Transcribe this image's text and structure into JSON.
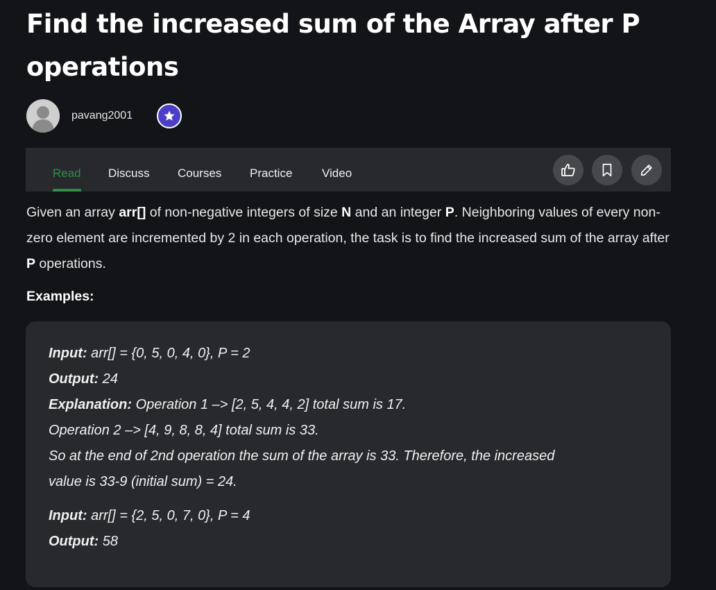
{
  "article": {
    "title": "Find the increased sum of the Array after P operations",
    "author": "pavang2001"
  },
  "tabs": [
    {
      "label": "Read",
      "active": true
    },
    {
      "label": "Discuss",
      "active": false
    },
    {
      "label": "Courses",
      "active": false
    },
    {
      "label": "Practice",
      "active": false
    },
    {
      "label": "Video",
      "active": false
    }
  ],
  "actions": {
    "like_icon": "thumbs-up-icon",
    "bookmark_icon": "bookmark-icon",
    "edit_icon": "pencil-icon"
  },
  "intro": {
    "t1": "Given an array ",
    "b1": "arr[]",
    "t2": " of non-negative integers of size ",
    "b2": "N",
    "t3": " and an integer ",
    "b3": "P",
    "t4": ". Neighboring values of every non-zero element are incremented by 2 in each operation, the task is to find the increased sum of the array after ",
    "b4": "P",
    "t5": " operations."
  },
  "examples_label": "Examples:",
  "examples": {
    "input_label": "Input:",
    "output_label": "Output:",
    "explanation_label": "Explanation:",
    "ex1_input": " arr[] = {0, 5, 0, 4, 0}, P = 2",
    "ex1_output": " 24",
    "ex1_explanation": " Operation 1 –> [2, 5, 4, 4, 2] total sum is 17.",
    "ex1_line2": "Operation 2 –> [4, 9, 8, 8, 4] total sum is 33.",
    "ex1_line3": "So at the end of 2nd operation the sum of the array is 33. Therefore, the increased",
    "ex1_line4": "value is 33-9 (initial sum) = 24.",
    "ex2_input": " arr[] = {2, 5, 0, 7, 0}, P = 4",
    "ex2_output": " 58"
  },
  "colors": {
    "background": "#131417",
    "panel": "#28292d",
    "accent_green": "#2f8d46",
    "badge_purple": "#4b3fc8",
    "icon_button": "#47484c"
  }
}
